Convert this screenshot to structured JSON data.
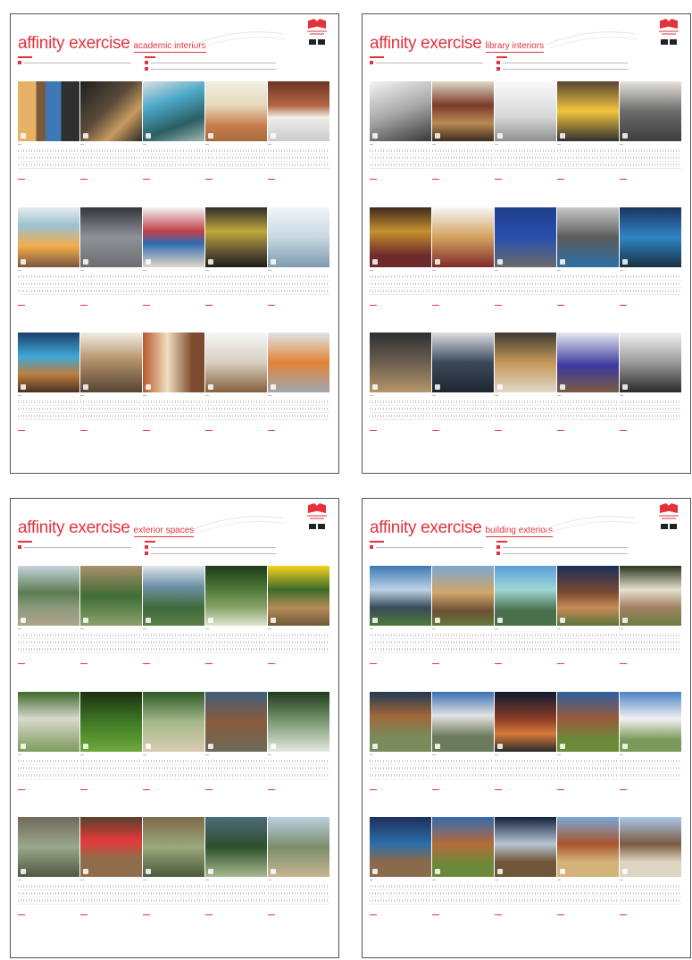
{
  "boards": [
    {
      "title": "affinity exercise",
      "subtitle": "academic interiors",
      "theme": "academic-interiors",
      "photos": [
        "bk0",
        "bk1",
        "bk2",
        "bk3",
        "bk4",
        "bk5",
        "bk6",
        "bk7",
        "bk8",
        "bk9",
        "bk10",
        "bk11",
        "bk12",
        "bk13",
        "bk14"
      ]
    },
    {
      "title": "affinity exercise",
      "subtitle": "library interiors",
      "theme": "library-interiors",
      "photos": [
        "bl0",
        "bl1",
        "bl2",
        "bl3",
        "bl4",
        "bl5",
        "bl6",
        "bl7",
        "bl8",
        "bl9",
        "bl10",
        "bl11",
        "bl12",
        "bl13",
        "bl14"
      ]
    },
    {
      "title": "affinity exercise",
      "subtitle": "exterior spaces",
      "theme": "exterior-spaces",
      "photos": [
        "be0",
        "be1",
        "be2",
        "be3",
        "be4",
        "be5",
        "be6",
        "be7",
        "be8",
        "be9",
        "be10",
        "be11",
        "be12",
        "be13",
        "be14"
      ]
    },
    {
      "title": "affinity exercise",
      "subtitle": "building exteriors",
      "theme": "building-exteriors",
      "photos": [
        "bx0",
        "bx1",
        "bx2",
        "bx3",
        "bx4",
        "bx5",
        "bx6",
        "bx7",
        "bx8",
        "bx9",
        "bx10",
        "bx11",
        "bx12",
        "bx13",
        "bx14"
      ]
    }
  ],
  "colors": {
    "accent": "#e4323c",
    "border": "#555555",
    "rule": "#cfcfcf"
  },
  "icons": {
    "logo": "red-book-logo-icon",
    "marks": "black-squares-icon"
  }
}
